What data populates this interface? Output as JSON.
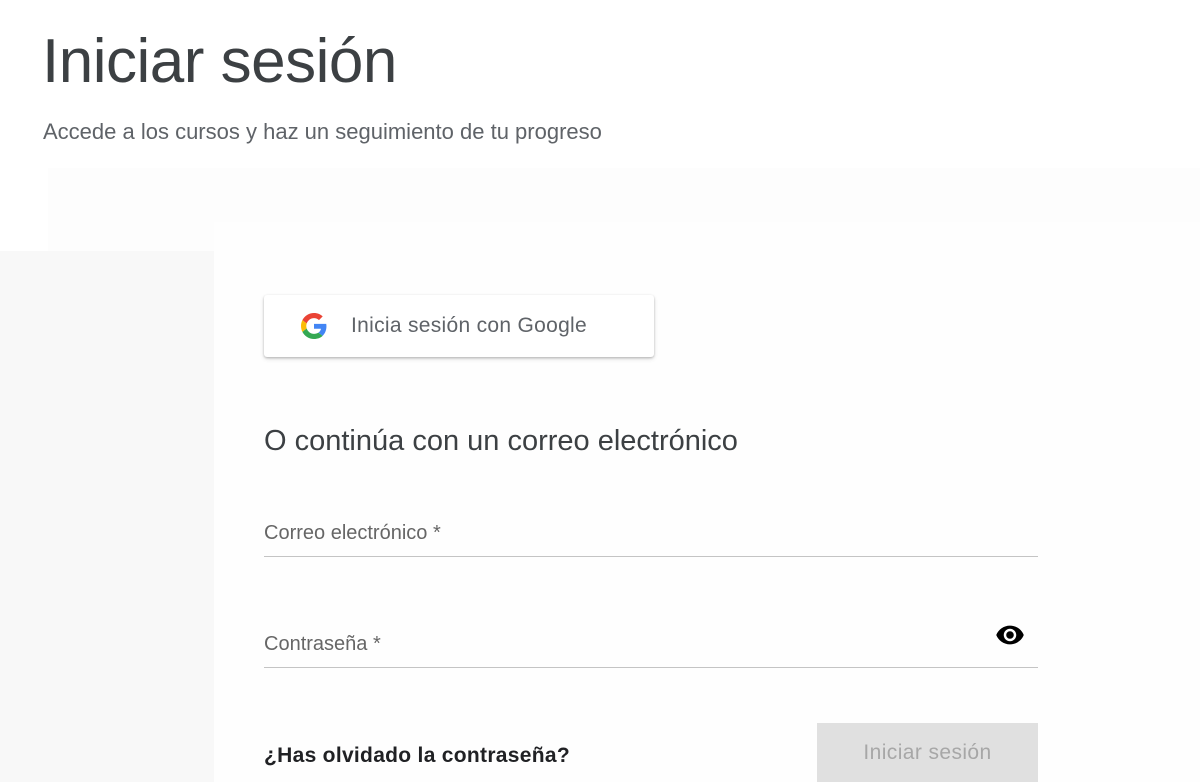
{
  "header": {
    "title": "Iniciar sesión",
    "subtitle": "Accede a los cursos y haz un seguimiento de tu progreso"
  },
  "google_signin": {
    "label": "Inicia sesión con Google",
    "icon": "google-logo-icon"
  },
  "email_section": {
    "title": "O continúa con un correo electrónico"
  },
  "form": {
    "email": {
      "label": "Correo electrónico *",
      "value": ""
    },
    "password": {
      "label": "Contraseña *",
      "value": "",
      "toggle_icon": "eye-icon"
    },
    "forgot_password": "¿Has olvidado la contraseña?",
    "submit_label": "Iniciar sesión"
  },
  "colors": {
    "title_text": "#3c4043",
    "subtitle_text": "#5f6368",
    "side_panel": "#f8f8f8",
    "submit_disabled_bg": "#e0e0e0",
    "submit_disabled_text": "#a7a7a7",
    "google_blue": "#4285F4",
    "google_red": "#EA4335",
    "google_yellow": "#FBBC05",
    "google_green": "#34A853"
  }
}
